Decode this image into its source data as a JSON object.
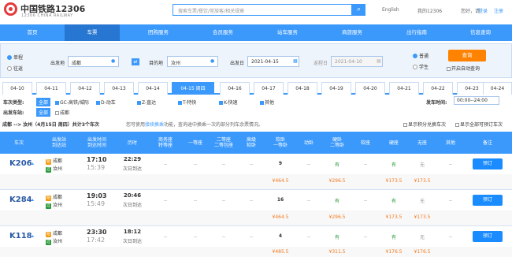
{
  "header": {
    "brand": "中国铁路12306",
    "brand_en": "12306 CHINA RAILWAY",
    "search_placeholder": "搜索车票/餐饮/常旅客/相关规章",
    "lang": "English",
    "my": "我的12306",
    "greet": "您好，请",
    "login": "登录",
    "register": "注册"
  },
  "nav": [
    "首页",
    "车票",
    "团购服务",
    "会员服务",
    "站车服务",
    "商旅服务",
    "出行指南",
    "信息查询"
  ],
  "query": {
    "oneway": "单程",
    "round": "往返",
    "from_label": "出发地",
    "from": "成都",
    "to_label": "目的地",
    "to": "汝州",
    "date_label": "出发日",
    "date": "2021-04-15",
    "return_label": "返程日",
    "return": "2021-04-10",
    "normal": "普通",
    "student": "学生",
    "query_btn": "查询",
    "auto": "开启自动查询"
  },
  "dates": [
    "04-10",
    "04-11",
    "04-12",
    "04-13",
    "04-14",
    "04-15 周四",
    "04-16",
    "04-17",
    "04-18",
    "04-19",
    "04-20",
    "04-21",
    "04-22",
    "04-23",
    "04-24"
  ],
  "filter": {
    "type_label": "车次类型:",
    "all": "全部",
    "types": [
      "GC-高铁/城际",
      "D-动车",
      "Z-直达",
      "T-特快",
      "K-快速",
      "其他"
    ],
    "station_label": "出发车站:",
    "station_all": "全部",
    "station": "成都",
    "time_label": "发车时间:",
    "time": "00:00--24:00"
  },
  "route": {
    "text": "成都 --> 汝州（4月15日 周四）共计3个车次",
    "tip_pre": "您可使用",
    "tip_link": "接续换乘",
    "tip_post": "功能，查询途中换乘一次的部分列车余票情况。",
    "opt1": "显示积分兑换车次",
    "opt2": "显示全部可预订车次"
  },
  "columns": [
    "车次",
    "出发站\n到达站",
    "出发时间\n到达时间",
    "历时",
    "商务座\n特等座",
    "一等座",
    "二等座\n二等包座",
    "高级\n软卧",
    "软卧\n一等卧",
    "动卧",
    "硬卧\n二等卧",
    "软座",
    "硬座",
    "无座",
    "其他",
    "备注"
  ],
  "trains": [
    {
      "no": "K206",
      "from": "成都",
      "to": "汝州",
      "dep": "17:10",
      "arr": "15:39",
      "dur": "22:29",
      "day": "次日到达",
      "rw": "9",
      "yw": "有",
      "yz": "有",
      "wz": "无",
      "rw_price": "¥464.5",
      "yw_price": "¥296.5",
      "yz_price": "¥173.5",
      "wz_price": "¥173.5"
    },
    {
      "no": "K284",
      "from": "成都",
      "to": "汝州",
      "dep": "19:03",
      "arr": "15:49",
      "dur": "20:46",
      "day": "次日到达",
      "rw": "16",
      "yw": "有",
      "yz": "有",
      "wz": "无",
      "rw_price": "¥464.5",
      "yw_price": "¥296.5",
      "yz_price": "¥173.5",
      "wz_price": "¥173.5"
    },
    {
      "no": "K118",
      "from": "成都",
      "to": "汝州",
      "dep": "23:30",
      "arr": "17:42",
      "dur": "18:12",
      "day": "次日到达",
      "rw": "4",
      "yw": "有",
      "yz": "有",
      "wz": "无",
      "rw_price": "¥485.5",
      "yw_price": "¥311.5",
      "yz_price": "¥176.5",
      "wz_price": "¥176.5"
    }
  ],
  "book": "预订",
  "dash": "--"
}
